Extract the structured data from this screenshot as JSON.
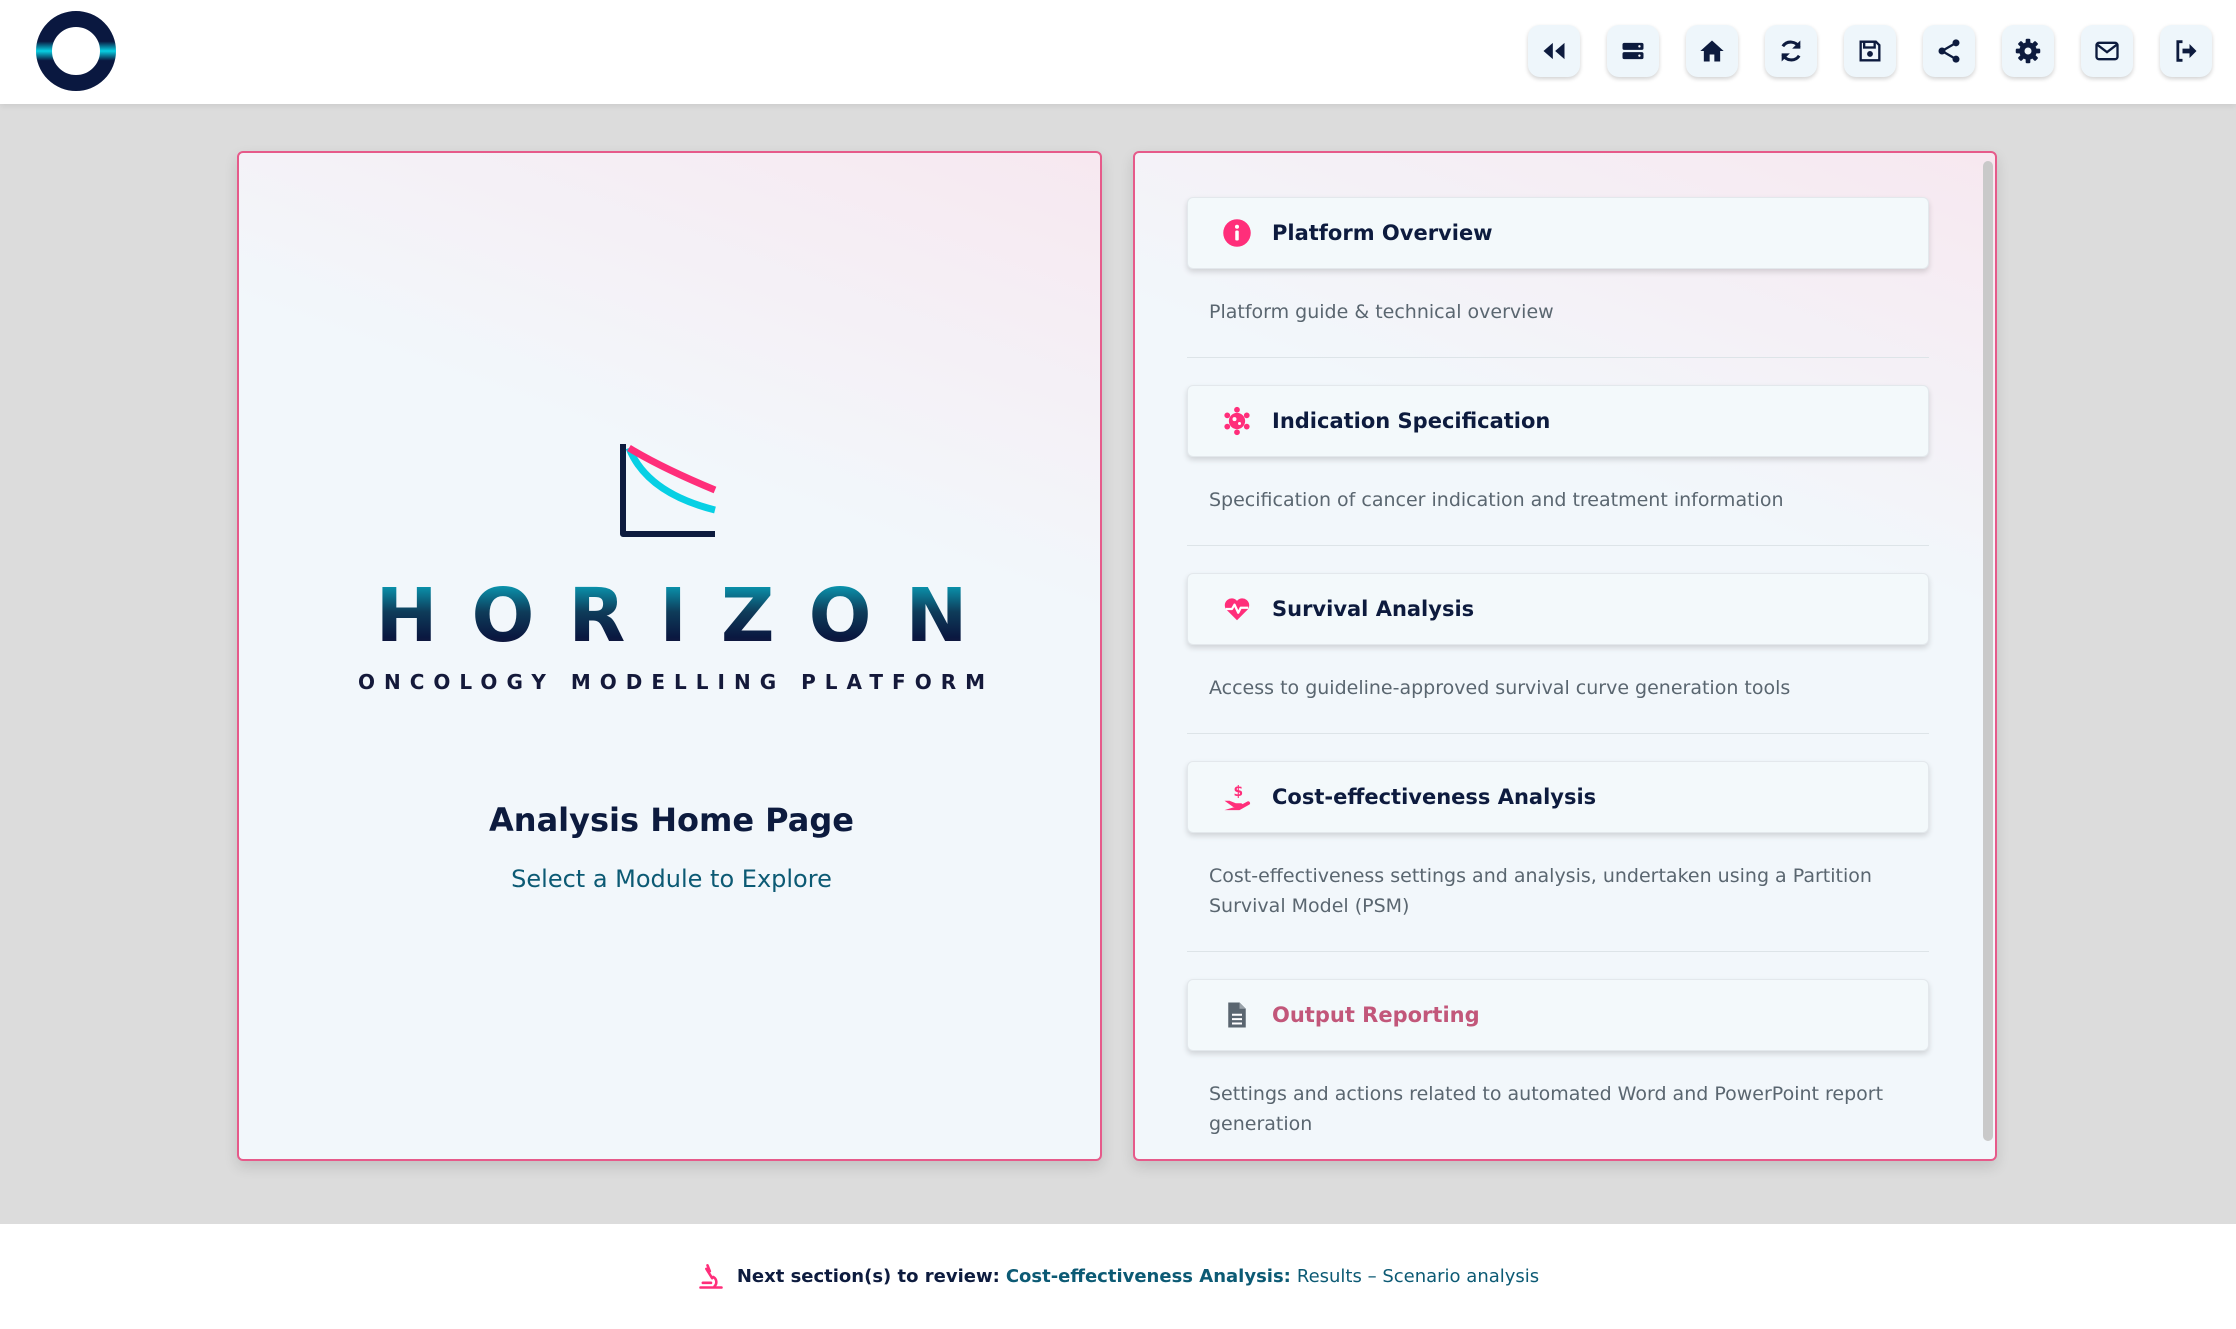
{
  "colors": {
    "accent": "#ff2e7a",
    "brand_cyan": "#0ad3e6",
    "navy": "#0d1b3e",
    "teal_text": "#0c5a74"
  },
  "toolbar": [
    {
      "name": "rewind-button",
      "icon": "rewind-icon"
    },
    {
      "name": "storage-button",
      "icon": "server-icon"
    },
    {
      "name": "home-button",
      "icon": "home-icon"
    },
    {
      "name": "refresh-button",
      "icon": "refresh-icon"
    },
    {
      "name": "save-button",
      "icon": "save-icon"
    },
    {
      "name": "share-button",
      "icon": "share-icon"
    },
    {
      "name": "settings-button",
      "icon": "gear-icon"
    },
    {
      "name": "mail-button",
      "icon": "mail-icon"
    },
    {
      "name": "logout-button",
      "icon": "logout-icon"
    }
  ],
  "brand": {
    "word": "HORIZON",
    "subtitle": "ONCOLOGY MODELLING PLATFORM"
  },
  "home": {
    "title": "Analysis Home Page",
    "subtitle": "Select a Module to Explore"
  },
  "modules": [
    {
      "label": "Platform Overview",
      "icon": "info-icon",
      "description": "Platform guide & technical overview",
      "enabled": true
    },
    {
      "label": "Indication Specification",
      "icon": "virus-icon",
      "description": "Specification of cancer indication and treatment information",
      "enabled": true
    },
    {
      "label": "Survival Analysis",
      "icon": "heartbeat-icon",
      "description": "Access to guideline-approved survival curve generation tools",
      "enabled": true
    },
    {
      "label": "Cost-effectiveness Analysis",
      "icon": "hand-dollar-icon",
      "description": "Cost-effectiveness settings and analysis, undertaken using a Partition Survival Model (PSM)",
      "enabled": true
    },
    {
      "label": "Output Reporting",
      "icon": "document-icon",
      "description": "Settings and actions related to automated Word and PowerPoint report generation",
      "enabled": false
    }
  ],
  "footer": {
    "lead": "Next section(s) to review:",
    "module": "Cost-effectiveness Analysis:",
    "item": "Results – Scenario analysis"
  }
}
